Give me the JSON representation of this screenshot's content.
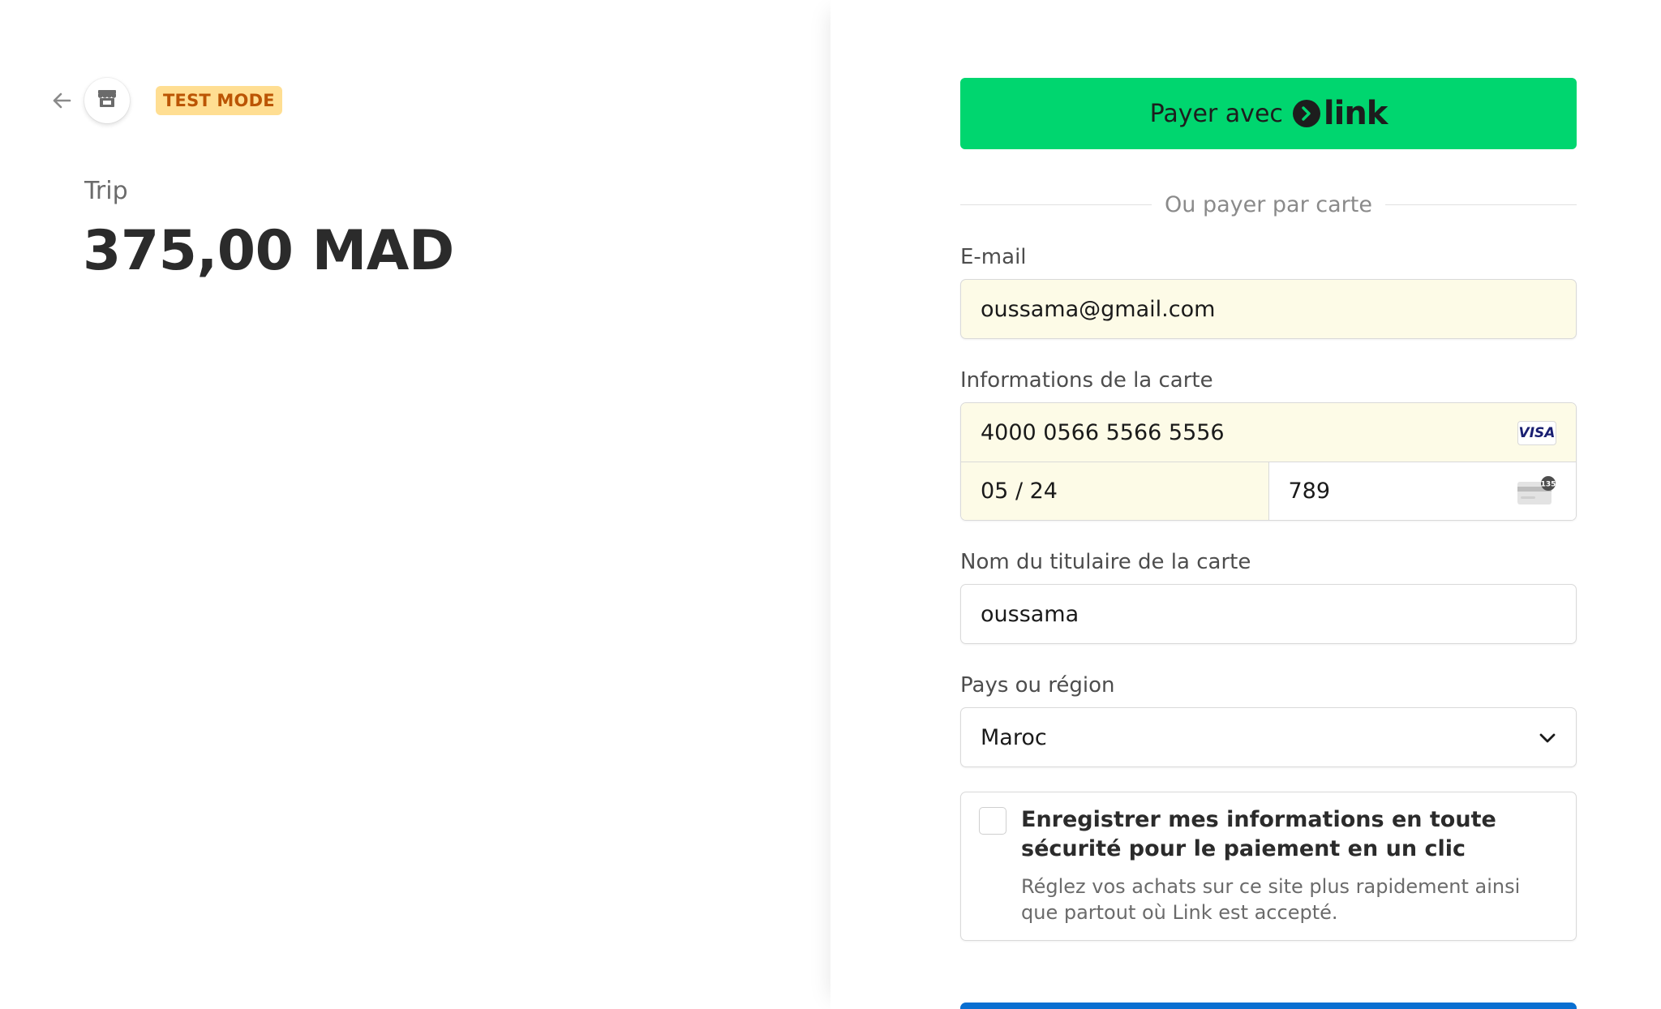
{
  "header": {
    "back_icon": "arrow-left-icon",
    "store_icon": "store-icon",
    "test_mode_label": "TEST MODE"
  },
  "summary": {
    "product_name": "Trip",
    "amount": "375,00 MAD"
  },
  "payment": {
    "link_button_text": "Payer avec",
    "link_logo_text": "link",
    "divider_text": "Ou payer par carte",
    "email": {
      "label": "E-mail",
      "value": "oussama@gmail.com"
    },
    "card": {
      "label": "Informations de la carte",
      "number": "4000 0566 5566 5556",
      "brand": "VISA",
      "expiry": "05 / 24",
      "cvc": "789",
      "cvc_icon_text": "135"
    },
    "cardholder": {
      "label": "Nom du titulaire de la carte",
      "value": "oussama"
    },
    "country": {
      "label": "Pays ou région",
      "value": "Maroc"
    },
    "save_info": {
      "checked": false,
      "title": "Enregistrer mes informations en toute sécurité pour le paiement en un clic",
      "description": "Réglez vos achats sur ce site plus rapidement ainsi que partout où Link est accepté."
    }
  },
  "colors": {
    "link_green": "#00d66f",
    "test_badge_bg": "#ffde92",
    "test_badge_text": "#bb5504",
    "autofill_bg": "#fdfbe7",
    "submit_blue": "#0a6fd1"
  }
}
